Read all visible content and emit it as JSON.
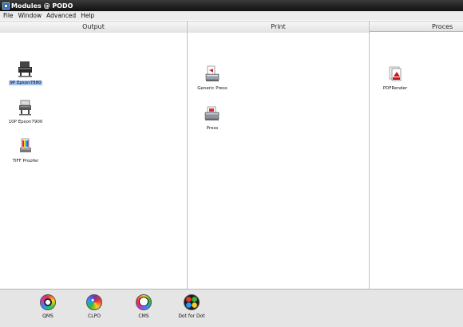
{
  "window": {
    "title": "Modules @ PODO"
  },
  "menu": [
    "File",
    "Window",
    "Advanced",
    "Help"
  ],
  "columns": [
    {
      "title": "Output",
      "modules": [
        {
          "label": "9P Epson7880",
          "icon": "large-printer-icon",
          "selected": true
        },
        {
          "label": "10P Epson7900",
          "icon": "printer-icon",
          "selected": false
        },
        {
          "label": "TIFF Proofer",
          "icon": "tiff-proofer-icon",
          "selected": false
        }
      ]
    },
    {
      "title": "Print",
      "modules": [
        {
          "label": "Generic Press",
          "icon": "generic-press-icon",
          "selected": false
        },
        {
          "label": "Press",
          "icon": "press-icon",
          "selected": false
        }
      ]
    },
    {
      "title": "Proces",
      "modules": [
        {
          "label": "PDFRender",
          "icon": "pdf-render-icon",
          "selected": false
        }
      ]
    }
  ],
  "tools": [
    {
      "label": "QMS",
      "icon": "qms-icon"
    },
    {
      "label": "CLPO",
      "icon": "clpo-icon"
    },
    {
      "label": "CMS",
      "icon": "cms-icon"
    },
    {
      "label": "Dot for Dot",
      "icon": "dot-for-dot-icon"
    }
  ]
}
